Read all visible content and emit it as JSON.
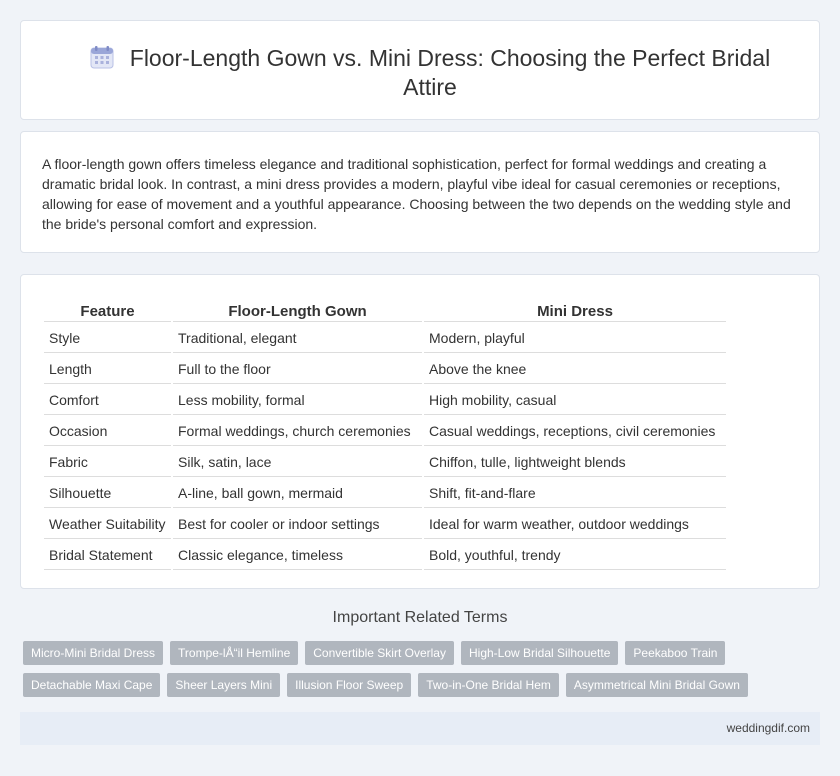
{
  "header": {
    "title": "Floor-Length Gown vs. Mini Dress: Choosing the Perfect Bridal Attire",
    "icon": "calendar-icon"
  },
  "intro": {
    "text": "A floor-length gown offers timeless elegance and traditional sophistication, perfect for formal weddings and creating a dramatic bridal look. In contrast, a mini dress provides a modern, playful vibe ideal for casual ceremonies or receptions, allowing for ease of movement and a youthful appearance. Choosing between the two depends on the wedding style and the bride's personal comfort and expression."
  },
  "table": {
    "headers": [
      "Feature",
      "Floor-Length Gown",
      "Mini Dress"
    ],
    "rows": [
      [
        "Style",
        "Traditional, elegant",
        "Modern, playful"
      ],
      [
        "Length",
        "Full to the floor",
        "Above the knee"
      ],
      [
        "Comfort",
        "Less mobility, formal",
        "High mobility, casual"
      ],
      [
        "Occasion",
        "Formal weddings, church ceremonies",
        "Casual weddings, receptions, civil ceremonies"
      ],
      [
        "Fabric",
        "Silk, satin, lace",
        "Chiffon, tulle, lightweight blends"
      ],
      [
        "Silhouette",
        "A-line, ball gown, mermaid",
        "Shift, fit-and-flare"
      ],
      [
        "Weather Suitability",
        "Best for cooler or indoor settings",
        "Ideal for warm weather, outdoor weddings"
      ],
      [
        "Bridal Statement",
        "Classic elegance, timeless",
        "Bold, youthful, trendy"
      ]
    ]
  },
  "related": {
    "heading": "Important Related Terms",
    "tags_row1": [
      "Micro-Mini Bridal Dress",
      "Trompe-lÅ“il Hemline",
      "Convertible Skirt Overlay",
      "High-Low Bridal Silhouette",
      "Peekaboo Train"
    ],
    "tags_row2": [
      "Detachable Maxi Cape",
      "Sheer Layers Mini",
      "Illusion Floor Sweep",
      "Two-in-One Bridal Hem",
      "Asymmetrical Mini Bridal Gown"
    ]
  },
  "footer": {
    "site": "weddingdif.com"
  },
  "colors": {
    "page_bg": "#f0f3f8",
    "tag_bg": "#b0b6be",
    "footer_bg": "#e7edf6",
    "icon_accent": "#9aa6d8"
  }
}
